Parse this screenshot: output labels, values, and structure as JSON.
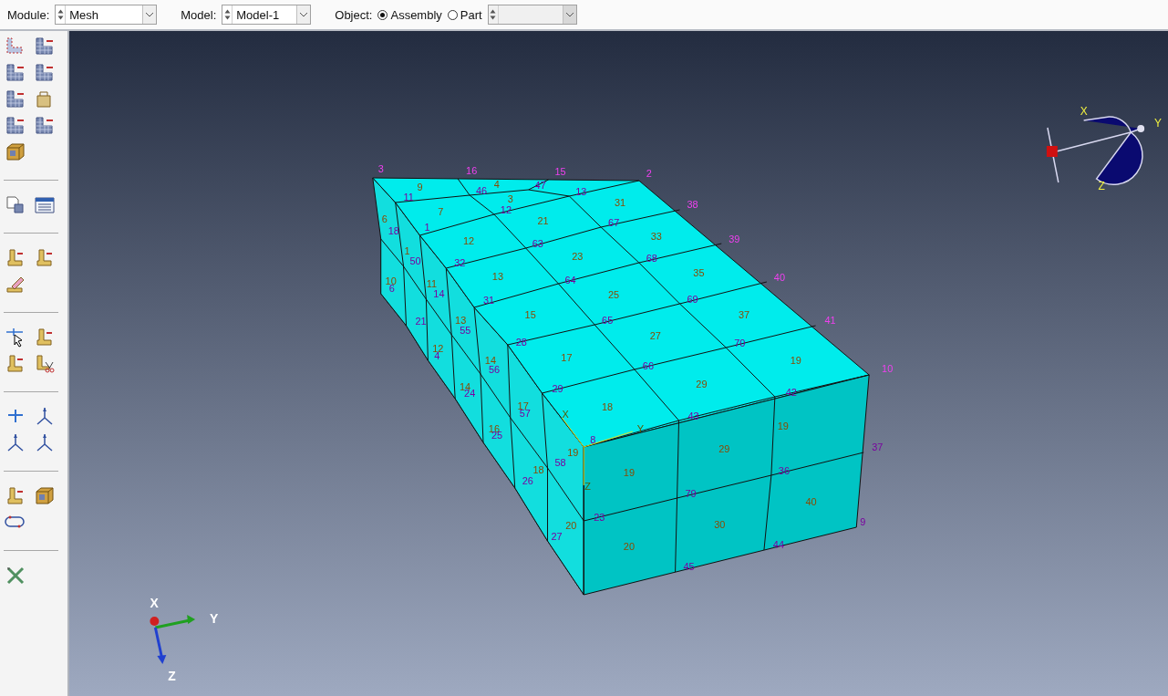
{
  "context_bar": {
    "module": {
      "label": "Module:",
      "value": "Mesh"
    },
    "model": {
      "label": "Model:",
      "value": "Model-1"
    },
    "object": {
      "label": "Object:",
      "options": [
        {
          "label": "Assembly",
          "selected": true
        },
        {
          "label": "Part",
          "selected": false
        }
      ],
      "part_combo": {
        "disabled": true
      }
    }
  },
  "viewport": {
    "node_labels": [
      "3",
      "16",
      "15",
      "2",
      "11",
      "46",
      "47",
      "13",
      "12",
      "38",
      "18",
      "1",
      "67",
      "63",
      "39",
      "50",
      "32",
      "68",
      "64",
      "40",
      "6",
      "14",
      "31",
      "69",
      "21",
      "65",
      "41",
      "55",
      "28",
      "70",
      "4",
      "56",
      "66",
      "10",
      "24",
      "29",
      "42",
      "57",
      "43",
      "25",
      "8",
      "37",
      "58",
      "36",
      "26",
      "79",
      "23",
      "9",
      "27",
      "44",
      "45"
    ],
    "element_labels": [
      "9",
      "4",
      "3",
      "31",
      "7",
      "6",
      "21",
      "12",
      "33",
      "1",
      "23",
      "10",
      "11",
      "13",
      "35",
      "25",
      "13",
      "15",
      "37",
      "27",
      "12",
      "14",
      "17",
      "19",
      "14",
      "29",
      "17",
      "18",
      "16",
      "19",
      "19",
      "29",
      "18",
      "19",
      "40",
      "20",
      "30",
      "20"
    ],
    "csys_labels": [
      "X",
      "Y",
      "Z"
    ],
    "triad_labels": [
      "X",
      "Y",
      "Z"
    ],
    "view_cube_labels": [
      "X",
      "Y",
      "Z"
    ]
  }
}
